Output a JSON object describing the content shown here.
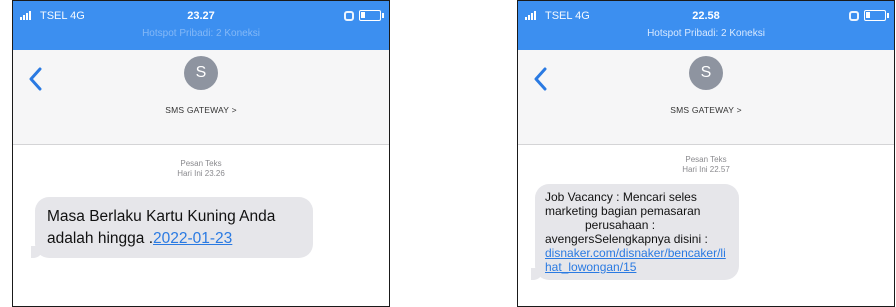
{
  "screens": [
    {
      "status": {
        "carrier": "TSEL 4G",
        "time": "23.27",
        "hotspot": "Hotspot Pribadi: 2 Koneksi"
      },
      "contact": {
        "initial": "S",
        "name": "SMS GATEWAY >"
      },
      "message": {
        "meta_type": "Pesan Teks",
        "meta_time": "Hari Ini 23.26",
        "text_before_link": "Masa Berlaku Kartu Kuning Anda adalah  hingga .",
        "link": "2022-01-23"
      }
    },
    {
      "status": {
        "carrier": "TSEL 4G",
        "time": "22.58",
        "hotspot": "Hotspot Pribadi: 2 Koneksi"
      },
      "contact": {
        "initial": "S",
        "name": "SMS GATEWAY >"
      },
      "message": {
        "meta_type": "Pesan Teks",
        "meta_time": "Hari Ini 22.57",
        "line_1": "Job Vacancy : Mencari seles marketing bagian pemasaran",
        "line_2": "perusahaan :",
        "line_3": "avengersSelengkapnya disini :",
        "link": "disnaker.com/disnaker/bencaker/lihat_lowongan/15"
      }
    }
  ],
  "colors": {
    "statusbar": "#3c8ff0",
    "bubble": "#e6e6ea",
    "link": "#2a7ae2",
    "accent": "#2a7ae2"
  },
  "icons": {
    "back": "chevron-left-icon",
    "signal": "signal-bars-icon",
    "battery": "battery-icon",
    "hotspot": "link-icon"
  }
}
